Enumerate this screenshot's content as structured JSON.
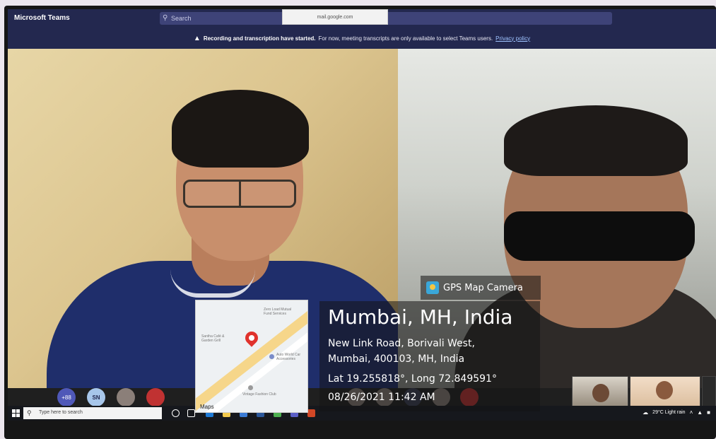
{
  "titlebar": {
    "app_title": "Microsoft Teams",
    "search_placeholder": "Search",
    "url_tooltip": "mail.google.com"
  },
  "banner": {
    "bold_text": "Recording and transcription have started.",
    "text": "For now, meeting transcripts are only available to select Teams users.",
    "link": "Privacy policy"
  },
  "gps": {
    "brand": "GPS Map Camera",
    "city": "Mumbai, MH, India",
    "address_line1": "New Link Road, Borivali West,",
    "address_line2": "Mumbai, 400103, MH, India",
    "coords": "Lat 19.255818°, Long 72.849591°",
    "datetime": "08/26/2021 11:42 AM"
  },
  "map": {
    "brand": "Maps",
    "pois": [
      "Zero Load Mutual Fund Services",
      "Santha Café & Garden Grill",
      "Auto World Car Accessories",
      "Vintage Fashion Club"
    ]
  },
  "controls": {
    "more_count": "+88",
    "initials": "SN"
  },
  "taskbar": {
    "search_placeholder": "Type here to search",
    "weather": "29°C  Light rain"
  },
  "colors": {
    "teams_bar": "#23284f",
    "accent": "#4f58b8",
    "taskbar": "#16181d"
  }
}
